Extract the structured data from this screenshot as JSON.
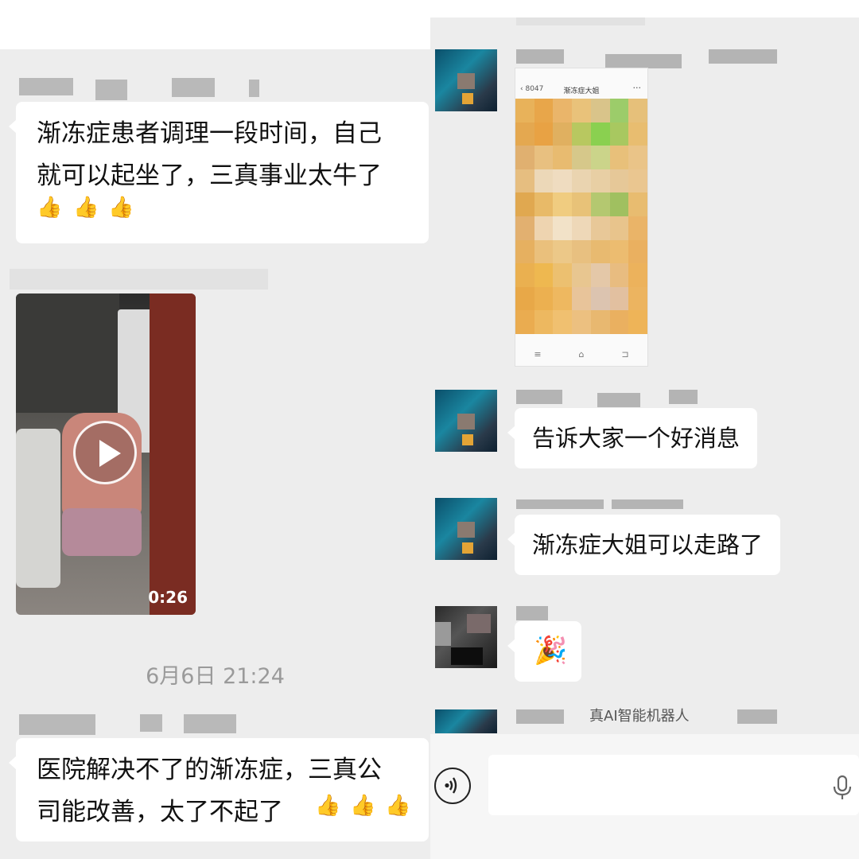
{
  "left_panel": {
    "partial_top_text": "",
    "messages": [
      {
        "id": "msg1",
        "text": "渐冻症患者调理一段时间，自己\n就可以起坐了，三真事业太牛了",
        "thumbs": [
          "👍",
          "👍",
          "👍"
        ]
      },
      {
        "id": "msg2",
        "type": "video",
        "duration": "0:26"
      },
      {
        "id": "msg3",
        "text": "医院解决不了的渐冻症，三真公\n司能改善，太了不起了",
        "thumbs": [
          "👍",
          "👍",
          "👍"
        ]
      }
    ],
    "timestamp": "6月6日 21:24"
  },
  "right_panel": {
    "screenshot_card": {
      "back_label": "8047",
      "title": "渐冻症大姐",
      "more": "···",
      "nav": [
        "≡",
        "⌂",
        "⊐"
      ]
    },
    "messages": [
      {
        "id": "rmsg1",
        "text": "告诉大家一个好消息"
      },
      {
        "id": "rmsg2",
        "text": "渐冻症大姐可以走路了"
      },
      {
        "id": "rmsg3",
        "type": "emoji",
        "emoji": "🎉"
      }
    ],
    "partial_bottom_message": "真AI智能机器人"
  },
  "input_bar": {
    "voice_icon": "voice-toggle-icon",
    "mic_icon": "microphone-icon",
    "placeholder": ""
  }
}
